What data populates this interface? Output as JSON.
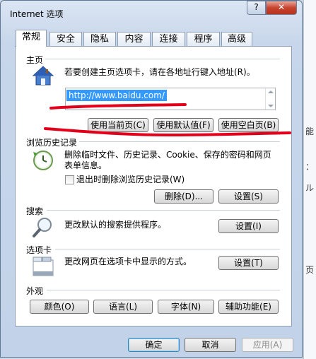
{
  "window": {
    "title": "Internet 选项",
    "help_label": "?",
    "close_label": "✕"
  },
  "tabs": [
    {
      "label": "常规",
      "active": true
    },
    {
      "label": "安全"
    },
    {
      "label": "隐私"
    },
    {
      "label": "内容"
    },
    {
      "label": "连接"
    },
    {
      "label": "程序"
    },
    {
      "label": "高级"
    }
  ],
  "homepage": {
    "section": "主页",
    "description": "若要创建主页选项卡，请在各地址行键入地址(R)。",
    "url": "http://www.baidu.com/",
    "btn_current": "使用当前页(C)",
    "btn_default": "使用默认值(F)",
    "btn_blank": "使用空白页(B)"
  },
  "history": {
    "section": "浏览历史记录",
    "description_line1": "删除临时文件、历史记录、Cookie、保存的密码和网页",
    "description_line2": "表单信息。",
    "checkbox_label": "退出时删除浏览历史记录(W)",
    "checkbox_checked": false,
    "btn_delete": "删除(D)...",
    "btn_settings": "设置(S)"
  },
  "search": {
    "section": "搜索",
    "description": "更改默认的搜索提供程序。",
    "btn_settings": "设置(I)"
  },
  "tabs_section": {
    "section": "选项卡",
    "description": "更改网页在选项卡中显示的方式。",
    "btn_settings": "设置(T)"
  },
  "appearance": {
    "section": "外观",
    "btn_colors": "颜色(O)",
    "btn_languages": "语言(L)",
    "btn_fonts": "字体(N)",
    "btn_accessibility": "辅助功能(E)"
  },
  "footer": {
    "ok": "确定",
    "cancel": "取消",
    "apply": "应用(A)"
  },
  "background": {
    "text1": "能",
    "text2": "：",
    "text3": "ル",
    "text4": "页"
  },
  "colors": {
    "selection": "#3399ff",
    "annotation": "#e3001b",
    "close_button": "#c7442e"
  }
}
